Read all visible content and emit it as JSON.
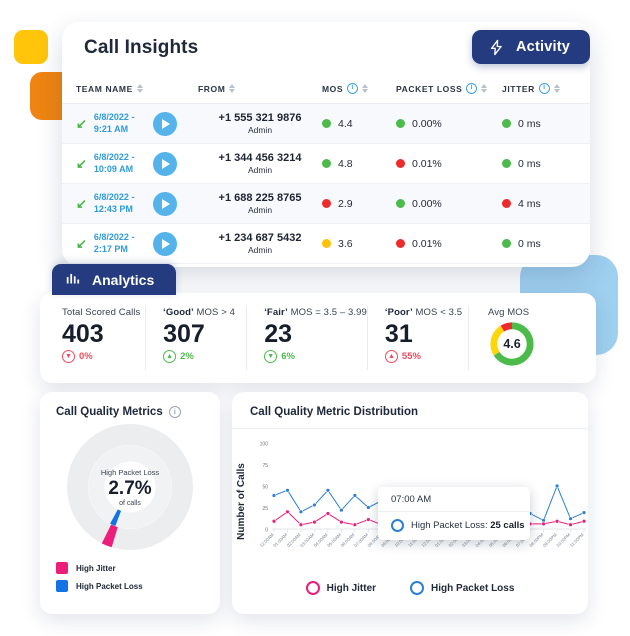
{
  "colors": {
    "navy": "#253B80",
    "blue": "#2B7FD4",
    "pink": "#EC1E79",
    "green": "#4CBB4C",
    "red": "#EE2B2B",
    "yellow": "#FFD60A",
    "light_blue": "#55B3EB",
    "deco_yellow": "#FFC50A",
    "deco_orange": "#EE8411",
    "deco_blue": "#9FD0EF"
  },
  "insights": {
    "title": "Call Insights",
    "activity_button": {
      "label": "Activity",
      "icon": "lightning-bolt-icon"
    },
    "columns": [
      {
        "label": "TEAM NAME",
        "info": false,
        "sortable": true
      },
      {
        "label": "FROM",
        "info": false,
        "sortable": true
      },
      {
        "label": "MOS",
        "info": true,
        "sortable": true
      },
      {
        "label": "PACKET LOSS",
        "info": true,
        "sortable": true
      },
      {
        "label": "JITTER",
        "info": true,
        "sortable": true
      }
    ],
    "rows": [
      {
        "direction_icon": "incoming-call-arrow-icon",
        "date": "6/8/2022 -",
        "time": "9:21 AM",
        "play": "play-icon",
        "from_number": "+1 555 321 9876",
        "from_sub": "Admin",
        "mos": "4.4",
        "mos_status": "#4CBB4C",
        "packet_loss": "0.00%",
        "packet_loss_status": "#4CBB4C",
        "jitter": "0 ms",
        "jitter_status": "#4CBB4C"
      },
      {
        "direction_icon": "incoming-call-arrow-icon",
        "date": "6/8/2022 -",
        "time": "10:09 AM",
        "play": "play-icon",
        "from_number": "+1 344 456 3214",
        "from_sub": "Admin",
        "mos": "4.8",
        "mos_status": "#4CBB4C",
        "packet_loss": "0.01%",
        "packet_loss_status": "#EE2B2B",
        "jitter": "0 ms",
        "jitter_status": "#4CBB4C"
      },
      {
        "direction_icon": "incoming-call-arrow-icon",
        "date": "6/8/2022 -",
        "time": "12:43 PM",
        "play": "play-icon",
        "from_number": "+1 688 225 8765",
        "from_sub": "Admin",
        "mos": "2.9",
        "mos_status": "#EE2B2B",
        "packet_loss": "0.00%",
        "packet_loss_status": "#4CBB4C",
        "jitter": "4 ms",
        "jitter_status": "#EE2B2B"
      },
      {
        "direction_icon": "incoming-call-arrow-icon",
        "date": "6/8/2022 -",
        "time": "2:17 PM",
        "play": "play-icon",
        "from_number": "+1 234 687 5432",
        "from_sub": "Admin",
        "mos": "3.6",
        "mos_status": "#FFC107",
        "packet_loss": "0.01%",
        "packet_loss_status": "#EE2B2B",
        "jitter": "0 ms",
        "jitter_status": "#4CBB4C"
      }
    ]
  },
  "analytics": {
    "tab_label": "Analytics",
    "tab_icon": "bar-chart-icon",
    "kpis": [
      {
        "label_strong": "",
        "label": "Total Scored Calls",
        "value": "403",
        "delta": "0%",
        "delta_dir": "down",
        "delta_color": "#EE4B5E"
      },
      {
        "label_strong": "‘Good’",
        "label": " MOS > 4",
        "value": "307",
        "delta": "2%",
        "delta_dir": "up",
        "delta_color": "#4CBB4C"
      },
      {
        "label_strong": "‘Fair’",
        "label": " MOS = 3.5 – 3.99",
        "value": "23",
        "delta": "6%",
        "delta_dir": "down",
        "delta_color": "#4CBB4C"
      },
      {
        "label_strong": "‘Poor’",
        "label": " MOS < 3.5",
        "value": "31",
        "delta": "55%",
        "delta_dir": "up",
        "delta_color": "#EE4B5E"
      }
    ],
    "avg_mos": {
      "label": "Avg MOS",
      "value": "4.6"
    }
  },
  "call_quality_metrics": {
    "title": "Call Quality Metrics",
    "info_icon": "info-icon",
    "center_top": "High Packet Loss",
    "center_value": "2.7%",
    "center_bottom": "of calls",
    "legend": [
      {
        "label": "High Jitter",
        "color": "#EC1E79"
      },
      {
        "label": "High Packet Loss",
        "color": "#1273E6"
      }
    ]
  },
  "distribution": {
    "title": "Call Quality Metric Distribution",
    "tooltip": {
      "time": "07:00 AM",
      "series": "High Packet Loss",
      "value": "25 calls"
    },
    "legend": [
      {
        "label": "High Jitter",
        "color": "#EC1E79"
      },
      {
        "label": "High Packet Loss",
        "color": "#2B7FD4"
      }
    ]
  },
  "chart_data": [
    {
      "type": "line",
      "title": "Call Quality Metric Distribution",
      "xlabel": "",
      "ylabel": "Number of Calls",
      "ylim": [
        0,
        100
      ],
      "yticks": [
        0,
        25,
        50,
        75,
        100
      ],
      "grid": false,
      "legend_position": "bottom",
      "categories": [
        "12:00AM",
        "01:00AM",
        "02:00AM",
        "03:00AM",
        "04:00AM",
        "05:00AM",
        "06:00AM",
        "07:00AM",
        "08:00AM",
        "09:00AM",
        "10:00AM",
        "11:00AM",
        "12:00PM",
        "01:00PM",
        "02:00PM",
        "03:00PM",
        "04:00PM",
        "05:00PM",
        "06:00PM",
        "07:00PM",
        "08:00PM",
        "09:00PM",
        "10:00PM",
        "11:00PM"
      ],
      "series": [
        {
          "name": "High Packet Loss",
          "color": "#2B7FD4",
          "values": [
            39,
            45,
            20,
            28,
            45,
            22,
            39,
            25,
            33,
            45,
            20,
            22,
            15,
            37,
            11,
            44,
            13,
            15,
            43,
            18,
            10,
            50,
            12,
            19
          ]
        },
        {
          "name": "High Jitter",
          "color": "#EC1E79",
          "values": [
            9,
            20,
            5,
            8,
            18,
            8,
            5,
            11,
            5,
            20,
            9,
            6,
            4,
            3,
            11,
            5,
            10,
            4,
            13,
            6,
            6,
            9,
            5,
            9,
            3
          ]
        }
      ],
      "annotations": [
        {
          "x": "07:00AM",
          "series": "High Packet Loss",
          "label": "High Packet Loss: 25 calls"
        }
      ]
    },
    {
      "type": "pie",
      "title": "Call Quality Metrics",
      "labels": [
        "High Jitter",
        "High Packet Loss",
        "Other"
      ],
      "values": [
        2.7,
        0.9,
        96.4
      ],
      "colors": [
        "#EC1E79",
        "#1273E6",
        "#E9EAEC"
      ],
      "center_label": "High Packet Loss 2.7% of calls",
      "legend_position": "bottom-left"
    },
    {
      "type": "pie",
      "title": "Avg MOS",
      "labels": [
        "Good",
        "Fair",
        "Poor"
      ],
      "values": [
        66,
        25,
        9
      ],
      "colors": [
        "#4CBB4C",
        "#FFD60A",
        "#EE2B2B"
      ],
      "center_label": "4.6",
      "legend_position": "none"
    }
  ]
}
